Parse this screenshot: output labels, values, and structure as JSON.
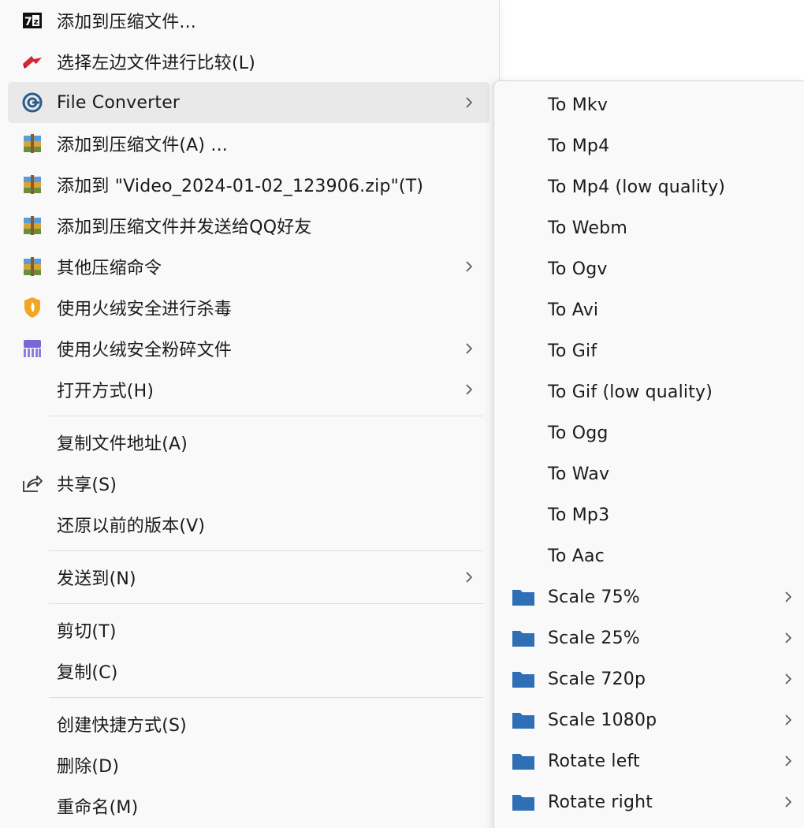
{
  "main_menu": {
    "items": [
      {
        "label": "添加到压缩文件..."
      },
      {
        "label": "选择左边文件进行比较(L)"
      },
      {
        "label": "File Converter"
      },
      {
        "label": "添加到压缩文件(A) ..."
      },
      {
        "label": "添加到 \"Video_2024-01-02_123906.zip\"(T)"
      },
      {
        "label": "添加到压缩文件并发送给QQ好友"
      },
      {
        "label": "其他压缩命令"
      },
      {
        "label": "使用火绒安全进行杀毒"
      },
      {
        "label": "使用火绒安全粉碎文件"
      },
      {
        "label": "打开方式(H)"
      },
      {
        "label": "复制文件地址(A)"
      },
      {
        "label": "共享(S)"
      },
      {
        "label": "还原以前的版本(V)"
      },
      {
        "label": "发送到(N)"
      },
      {
        "label": "剪切(T)"
      },
      {
        "label": "复制(C)"
      },
      {
        "label": "创建快捷方式(S)"
      },
      {
        "label": "删除(D)"
      },
      {
        "label": "重命名(M)"
      }
    ]
  },
  "submenu": {
    "items": [
      {
        "label": "To Mkv"
      },
      {
        "label": "To Mp4"
      },
      {
        "label": "To Mp4 (low quality)"
      },
      {
        "label": "To Webm"
      },
      {
        "label": "To Ogv"
      },
      {
        "label": "To Avi"
      },
      {
        "label": "To Gif"
      },
      {
        "label": "To Gif (low quality)"
      },
      {
        "label": "To Ogg"
      },
      {
        "label": "To Wav"
      },
      {
        "label": "To Mp3"
      },
      {
        "label": "To Aac"
      },
      {
        "label": "Scale 75%"
      },
      {
        "label": "Scale 25%"
      },
      {
        "label": "Scale 720p"
      },
      {
        "label": "Scale 1080p"
      },
      {
        "label": "Rotate left"
      },
      {
        "label": "Rotate right"
      }
    ]
  },
  "colors": {
    "menu_bg": "#f9f9f9",
    "hover_bg": "#e9e9e9",
    "folder_blue": "#2f6fb5"
  }
}
